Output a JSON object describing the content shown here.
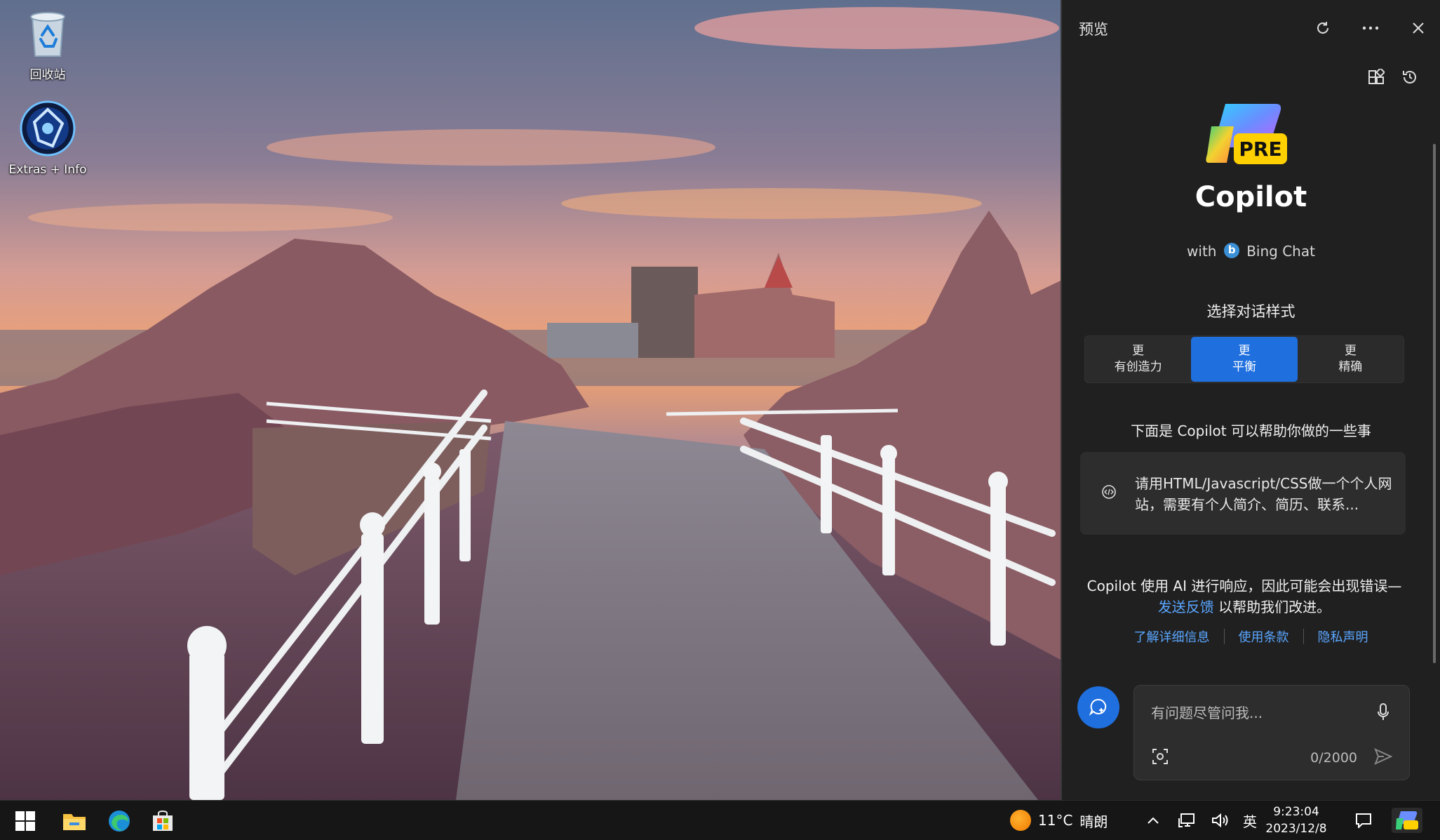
{
  "desktop": {
    "icons": [
      {
        "label": "回收站",
        "icon": "recycle-bin-icon"
      },
      {
        "label": "Extras + Info",
        "icon": "extras-info-icon"
      }
    ]
  },
  "copilot": {
    "header_title": "预览",
    "header_buttons": [
      "refresh-icon",
      "more-options-icon",
      "close-icon"
    ],
    "tools": [
      "plugins-icon",
      "history-icon"
    ],
    "logo_badge": "PRE",
    "product_name": "Copilot",
    "with_text": "with",
    "bing_chat": "Bing Chat",
    "style_title": "选择对话样式",
    "styles": [
      {
        "line1": "更",
        "line2": "有创造力",
        "active": false
      },
      {
        "line1": "更",
        "line2": "平衡",
        "active": true
      },
      {
        "line1": "更",
        "line2": "精确",
        "active": false
      }
    ],
    "help_title": "下面是 Copilot 可以帮助你做的一些事",
    "suggestion": "请用HTML/Javascript/CSS做一个个人网站，需要有个人简介、简历、联系...",
    "disclaimer_before": "Copilot 使用 AI 进行响应，因此可能会出现错误—",
    "disclaimer_link": "发送反馈",
    "disclaimer_after": " 以帮助我们改进。",
    "links": [
      "了解详细信息",
      "使用条款",
      "隐私声明"
    ],
    "input_placeholder": "有问题尽管问我...",
    "char_count": "0/2000",
    "accent": "#1f6fdf",
    "link_color": "#5aa6ff"
  },
  "taskbar": {
    "apps": [
      "windows-start-icon",
      "file-explorer-icon",
      "edge-browser-icon",
      "microsoft-store-icon"
    ],
    "weather_temp": "11°C",
    "weather_desc": "晴朗",
    "language": "英",
    "time": "9:23:04",
    "date": "2023/12/8"
  }
}
